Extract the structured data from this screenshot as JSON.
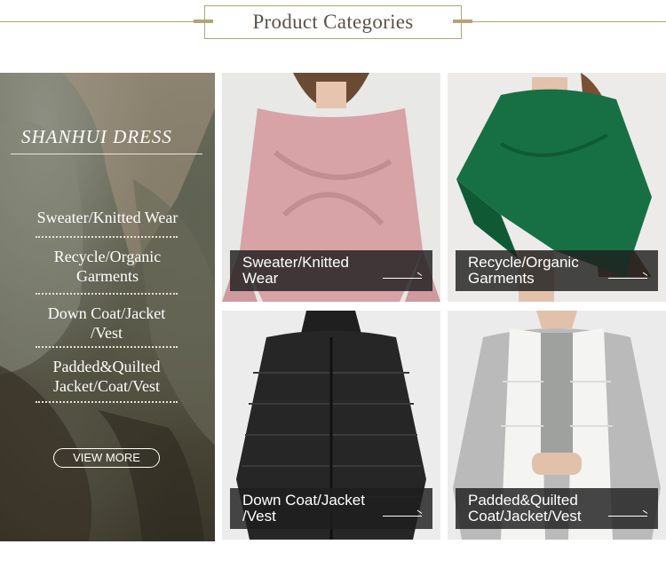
{
  "header": {
    "title": "Product Categories"
  },
  "promo": {
    "brand": "SHANHUI DRESS",
    "categories": [
      "Sweater/Knitted Wear",
      "Recycle/Organic Garments",
      "Down Coat/Jacket /Vest",
      "Padded&Quilted Jacket/Coat/Vest"
    ],
    "button": "VIEW MORE"
  },
  "tiles": [
    {
      "caption": "Sweater/Knitted Wear"
    },
    {
      "caption": "Recycle/Organic Garments"
    },
    {
      "caption": "Down Coat/Jacket /Vest"
    },
    {
      "caption": "Padded&Quilted Coat/Jacket/Vest"
    }
  ],
  "colors": {
    "accent_gold": "#b5a278",
    "caption_bg": "#1e1e1e"
  }
}
